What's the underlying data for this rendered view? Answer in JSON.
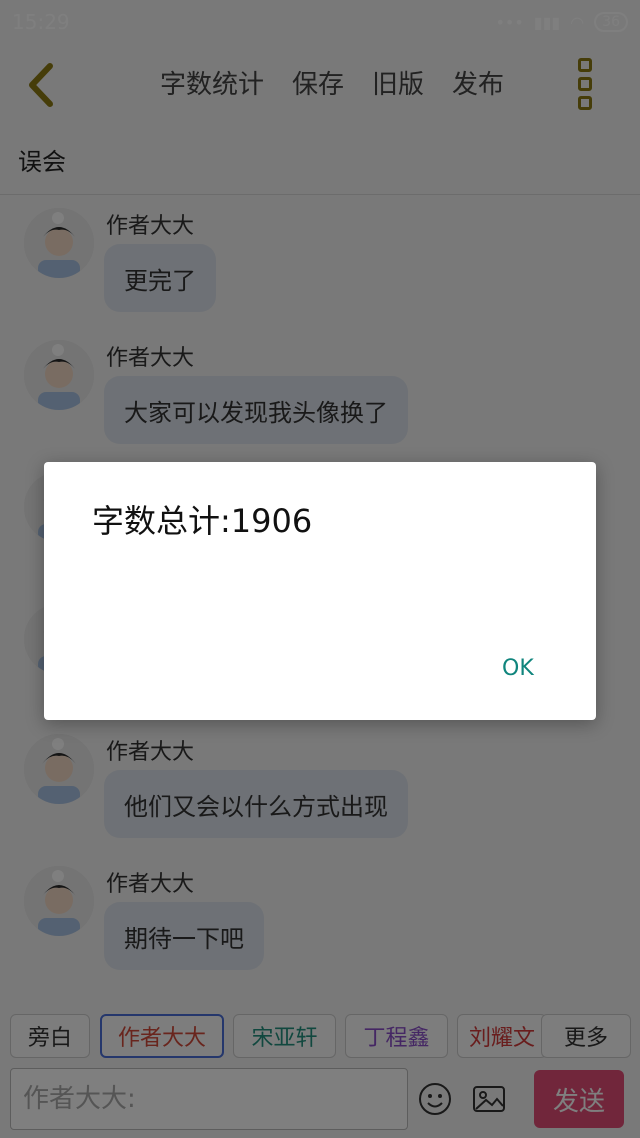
{
  "status": {
    "time": "15:29",
    "battery": "36"
  },
  "toolbar": {
    "items": [
      "字数统计",
      "保存",
      "旧版",
      "发布"
    ]
  },
  "title": "误会",
  "messages": [
    {
      "sender": "作者大大",
      "text": "更完了"
    },
    {
      "sender": "作者大大",
      "text": "大家可以发现我头像换了"
    },
    {
      "sender": "作者大大",
      "text": ""
    },
    {
      "sender": "作者大大",
      "text": ""
    },
    {
      "sender": "作者大大",
      "text": "他们又会以什么方式出现"
    },
    {
      "sender": "作者大大",
      "text": "期待一下吧"
    }
  ],
  "roles": [
    {
      "label": "旁白",
      "color": "#333333"
    },
    {
      "label": "作者大大",
      "color": "#d24b3b"
    },
    {
      "label": "宋亚轩",
      "color": "#23907e"
    },
    {
      "label": "丁程鑫",
      "color": "#8a4fc9"
    },
    {
      "label": "刘耀文",
      "color": "#d23b3b"
    },
    {
      "label": "更多",
      "color": "#333333"
    }
  ],
  "input": {
    "placeholder": "作者大大:"
  },
  "send_label": "发送",
  "dialog": {
    "message": "字数总计:1906",
    "ok_label": "OK"
  },
  "colors": {
    "accent": "#e24d77",
    "ok": "#10857d",
    "back": "#8c7a12"
  }
}
